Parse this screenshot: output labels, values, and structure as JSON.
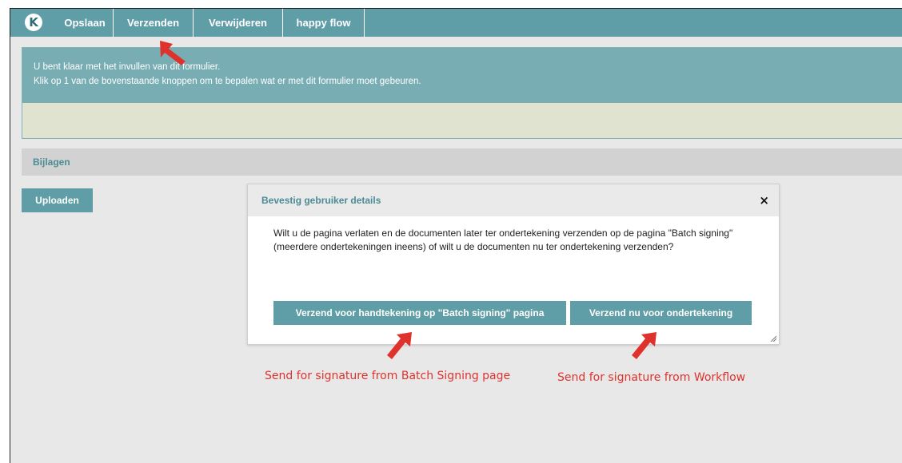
{
  "toolbar": {
    "logo_letter": "K",
    "buttons": [
      "Opslaan",
      "Verzenden",
      "Verwijderen",
      "happy flow"
    ]
  },
  "info_panel": {
    "line1": "U bent klaar met het invullen van dit formulier.",
    "line2": "Klik op 1 van de bovenstaande knoppen om te bepalen wat er met dit formulier moet gebeuren."
  },
  "attachments": {
    "title": "Bijlagen",
    "upload_label": "Uploaden"
  },
  "modal": {
    "title": "Bevestig gebruiker details",
    "close": "×",
    "body": "Wilt u de pagina verlaten en de documenten later ter ondertekening verzenden op de pagina \"Batch signing\" (meerdere ondertekeningen ineens) of wilt u de documenten nu ter ondertekening verzenden?",
    "button_batch": "Verzend voor handtekening op \"Batch signing\" pagina",
    "button_now": "Verzend nu voor ondertekening"
  },
  "annotations": {
    "batch": "Send for signature from Batch Signing page",
    "workflow": "Send for signature from Workflow"
  },
  "colors": {
    "toolbar": "#5f9ea6",
    "info_top": "#78adb4",
    "info_bottom": "#dfe3cf",
    "button": "#5f9ea6",
    "annotation_red": "#e0322c"
  }
}
